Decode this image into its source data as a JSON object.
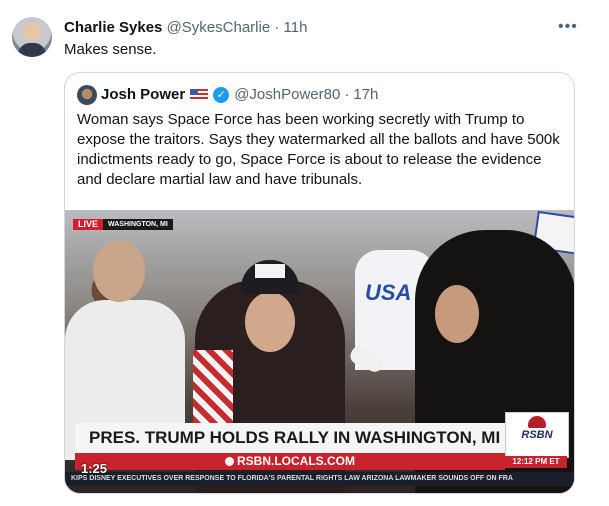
{
  "tweet": {
    "author_name": "Charlie Sykes",
    "author_handle": "@SykesCharlie",
    "separator": "·",
    "time": "11h",
    "more_icon": "more-horizontal-icon",
    "text": "Makes sense."
  },
  "quote": {
    "author_name": "Josh Power",
    "flag_icon": "us-flag-icon",
    "verified_icon": "verified-badge-icon",
    "verified_glyph": "✓",
    "author_handle": "@JoshPower80",
    "separator": "·",
    "time": "17h",
    "text": "Woman says Space Force has been working secretly with Trump to expose the traitors. Says they watermarked all the ballots and have 500k indictments ready to go, Space Force is about to release the evidence and declare martial law and have tribunals."
  },
  "video": {
    "live_label": "LIVE",
    "location_label": "WASHINGTON, MI",
    "headline": "PRES. TRUMP HOLDS RALLY IN WASHINGTON, MI",
    "url": "RSBN.LOCALS.COM",
    "logo": "RSBN",
    "clock": "12:12 PM ET",
    "ticker": "KIPS DISNEY EXECUTIVES OVER RESPONSE TO FLORIDA'S PARENTAL RIGHTS LAW   ARIZONA LAWMAKER SOUNDS OFF ON FRA",
    "jersey_text": "USA",
    "duration": "1:25"
  },
  "colors": {
    "text_primary": "#0f1419",
    "text_muted": "#536471",
    "border": "#cfd9de",
    "verified": "#1d9bf0",
    "news_red": "#c8232c"
  }
}
